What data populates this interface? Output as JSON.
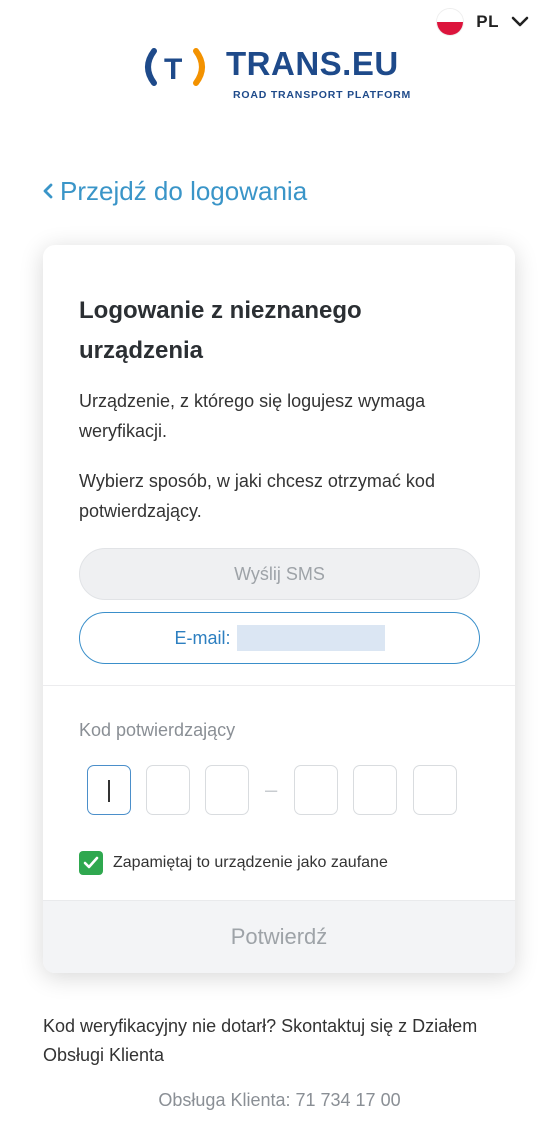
{
  "language": {
    "code": "PL",
    "flag_icon": "poland-flag-icon"
  },
  "logo": {
    "text": "TRANS.EU",
    "tagline": "ROAD TRANSPORT PLATFORM",
    "brand_color": "#1e4a8a",
    "accent_color": "#f39200"
  },
  "back_link": {
    "label": "Przejdź do logowania"
  },
  "card": {
    "title": "Logowanie z nieznanego urządzenia",
    "description": "Urządzenie, z którego się logujesz wymaga weryfikacji.",
    "instruction": "Wybierz sposób, w jaki chcesz otrzymać kod potwierdzający.",
    "sms_button": "Wyślij SMS",
    "email_button_prefix": "E-mail:",
    "code_label": "Kod potwierdzający",
    "code_separator": "–",
    "remember_label": "Zapamiętaj to urządzenie jako zaufane",
    "remember_checked": true,
    "confirm_button": "Potwierdź"
  },
  "footer": {
    "help_text": "Kod weryfikacyjny nie dotarł? Skontaktuj się z Działem Obsługi Klienta",
    "support": "Obsługa Klienta: 71 734 17 00"
  },
  "colors": {
    "link": "#3a95c8",
    "primary_border": "#3a8fca",
    "checkbox": "#2fa84f"
  }
}
